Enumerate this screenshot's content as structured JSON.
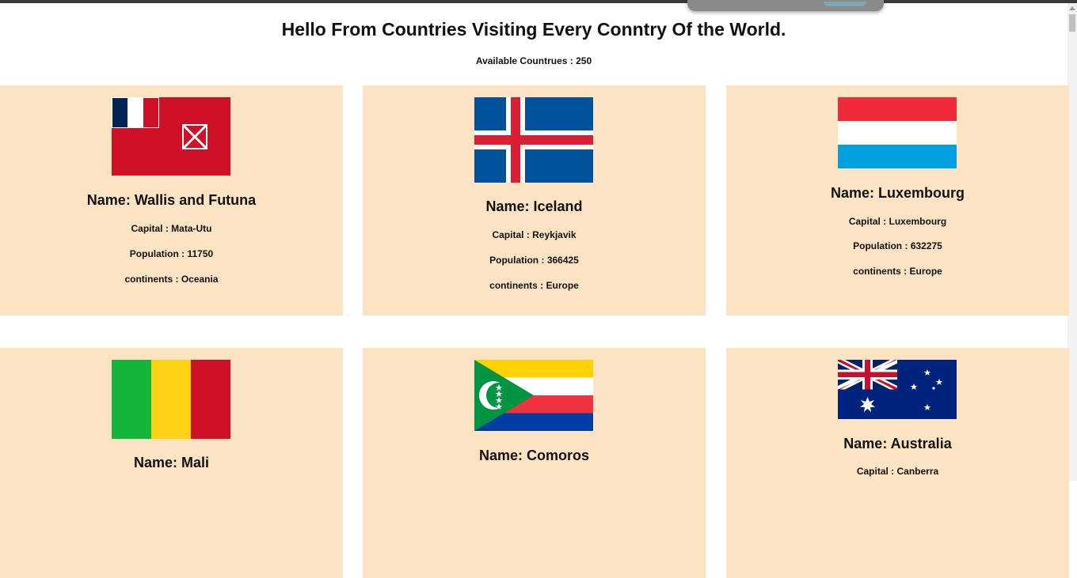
{
  "header": {
    "title": "Hello From Countries Visiting Every Conntry Of the World.",
    "count_label": "Available Countrues :",
    "count_value": "250"
  },
  "labels": {
    "name_prefix": "Name:",
    "capital_prefix": "Capital :",
    "population_prefix": "Population :",
    "continents_prefix": "continents :"
  },
  "countries": [
    {
      "name": "Wallis and Futuna",
      "capital": "Mata-Utu",
      "population": "11750",
      "continents": "Oceania",
      "flag_icon": "wallis-futuna-flag-icon"
    },
    {
      "name": "Iceland",
      "capital": "Reykjavik",
      "population": "366425",
      "continents": "Europe",
      "flag_icon": "iceland-flag-icon"
    },
    {
      "name": "Luxembourg",
      "capital": "Luxembourg",
      "population": "632275",
      "continents": "Europe",
      "flag_icon": "luxembourg-flag-icon"
    },
    {
      "name": "Mali",
      "flag_icon": "mali-flag-icon"
    },
    {
      "name": "Comoros",
      "flag_icon": "comoros-flag-icon"
    },
    {
      "name": "Australia",
      "capital": "Canberra",
      "flag_icon": "australia-flag-icon"
    }
  ],
  "colors": {
    "card_background": "#fce3c3",
    "page_background": "#ffffff"
  }
}
